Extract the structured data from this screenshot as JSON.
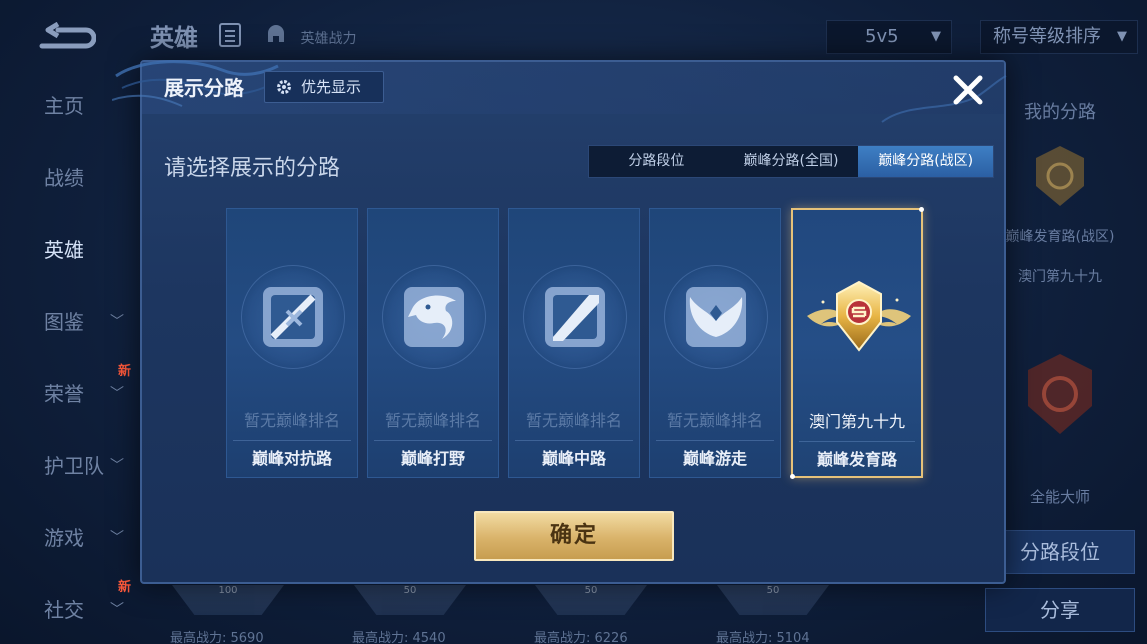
{
  "background": {
    "nav_items": [
      {
        "label": "主页",
        "chevron": false,
        "badge": ""
      },
      {
        "label": "战绩",
        "chevron": false,
        "badge": ""
      },
      {
        "label": "英雄",
        "chevron": false,
        "badge": "",
        "active": true
      },
      {
        "label": "图鉴",
        "chevron": true,
        "badge": ""
      },
      {
        "label": "荣誉",
        "chevron": true,
        "badge": "新"
      },
      {
        "label": "护卫队",
        "chevron": true,
        "badge": ""
      },
      {
        "label": "游戏",
        "chevron": true,
        "badge": ""
      },
      {
        "label": "社交",
        "chevron": true,
        "badge": "新"
      }
    ],
    "page_title": "英雄",
    "hero_power_label": "英雄战力",
    "mode_select": "5v5",
    "sort_select": "称号等级排序",
    "right_panel": {
      "my_lane_label": "我的分路",
      "lane_title": "巅峰发育路(战区)",
      "lane_rank": "澳门第九十九",
      "master_label": "全能大师",
      "lane_rank_button": "分路段位",
      "share_button": "分享"
    },
    "bottom_stats": [
      {
        "label": "最高战力: 5690",
        "crest": "100"
      },
      {
        "label": "最高战力: 4540",
        "crest": "50"
      },
      {
        "label": "最高战力: 6226",
        "crest": "50"
      },
      {
        "label": "最高战力: 5104",
        "crest": "50"
      }
    ]
  },
  "modal": {
    "title": "展示分路",
    "priority_button": "优先显示",
    "prompt": "请选择展示的分路",
    "tabs": [
      "分路段位",
      "巅峰分路(全国)",
      "巅峰分路(战区)"
    ],
    "selected_tab": 2,
    "cards": [
      {
        "rank": "暂无巅峰排名",
        "lane": "巅峰对抗路",
        "icon": "sword-crossed-icon"
      },
      {
        "rank": "暂无巅峰排名",
        "lane": "巅峰打野",
        "icon": "dragon-icon"
      },
      {
        "rank": "暂无巅峰排名",
        "lane": "巅峰中路",
        "icon": "slash-lane-icon"
      },
      {
        "rank": "暂无巅峰排名",
        "lane": "巅峰游走",
        "icon": "wings-icon"
      },
      {
        "rank": "澳门第九十九",
        "lane": "巅峰发育路",
        "icon": "gold-crest-icon",
        "selected": true
      }
    ],
    "confirm_button": "确定"
  },
  "colors": {
    "accent_gold": "#e6c27a",
    "tab_selected": "#3e7fc4",
    "modal_bg": "#1d3660"
  }
}
